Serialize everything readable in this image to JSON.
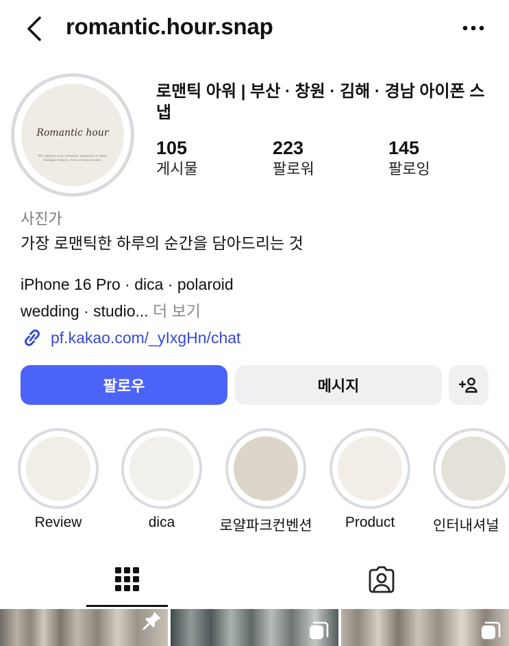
{
  "header": {
    "username": "romantic.hour.snap",
    "back_icon": "chevron-left-icon",
    "more_icon": "more-horizontal-icon"
  },
  "profile": {
    "avatar": {
      "title": "Romantic hour",
      "subtitle": "We capture your romantic moments so their feelings remain, even as time passes."
    },
    "display_name": "로맨틱 아워 | 부산 · 창원 · 김해 · 경남 아이폰 스냅",
    "stats": [
      {
        "value": "105",
        "label": "게시물"
      },
      {
        "value": "223",
        "label": "팔로워"
      },
      {
        "value": "145",
        "label": "팔로잉"
      }
    ],
    "category": "사진가",
    "bio_line1": "가장 로맨틱한 하루의 순간을 담아드리는 것",
    "bio_line2": "iPhone 16 Pro · dica · polaroid",
    "bio_line3": "wedding · studio...",
    "more_label": "더 보기",
    "link": "pf.kakao.com/_yIxgHn/chat"
  },
  "actions": {
    "follow_label": "팔로우",
    "message_label": "메시지",
    "add_person_icon": "add-person-icon"
  },
  "highlights": [
    {
      "label": "Review",
      "color": "#f1eee7"
    },
    {
      "label": "dica",
      "color": "#f1f0eb"
    },
    {
      "label": "로얄파크컨벤션",
      "color": "#dcd5c9"
    },
    {
      "label": "Product",
      "color": "#f2eee7"
    },
    {
      "label": "인터내셔널",
      "color": "#e6e1d8"
    }
  ],
  "tabs": [
    {
      "name": "grid",
      "icon": "grid-icon",
      "active": true
    },
    {
      "name": "tagged",
      "icon": "tagged-person-icon",
      "active": false
    }
  ],
  "colors": {
    "accent": "#4c63f7",
    "link": "#3749d4",
    "secondary_button": "#eff0f2",
    "muted_text": "#7a7a7a"
  }
}
